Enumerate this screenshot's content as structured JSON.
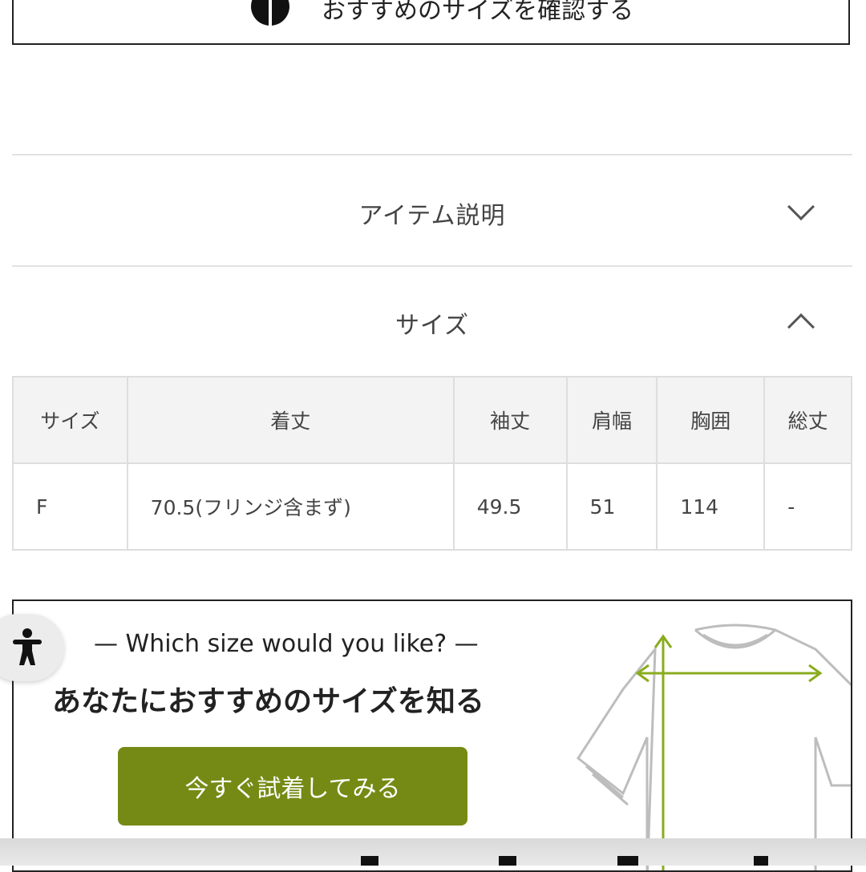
{
  "top_button": {
    "label": "おすすめのサイズを確認する",
    "icon": "half-circle-icon"
  },
  "accordion": {
    "item_description": {
      "title": "アイテム説明",
      "state": "collapsed",
      "icon": "chevron-down-icon"
    },
    "size": {
      "title": "サイズ",
      "state": "expanded",
      "icon": "chevron-up-icon"
    }
  },
  "size_table": {
    "headers": [
      "サイズ",
      "着丈",
      "袖丈",
      "肩幅",
      "胸囲",
      "総丈"
    ],
    "rows": [
      [
        "F",
        "70.5(フリンジ含まず)",
        "49.5",
        "51",
        "114",
        "-"
      ]
    ]
  },
  "size_promo": {
    "subtitle": "— Which size would you like? —",
    "heading": "あなたにおすすめのサイズを知る",
    "cta_label": "今すぐ試着してみる",
    "cta_color": "#758a14",
    "illustration": "t-shirt-measurement-illustration",
    "accent_color": "#8aac1e"
  },
  "accessibility_button": {
    "icon": "accessibility-person-icon"
  }
}
